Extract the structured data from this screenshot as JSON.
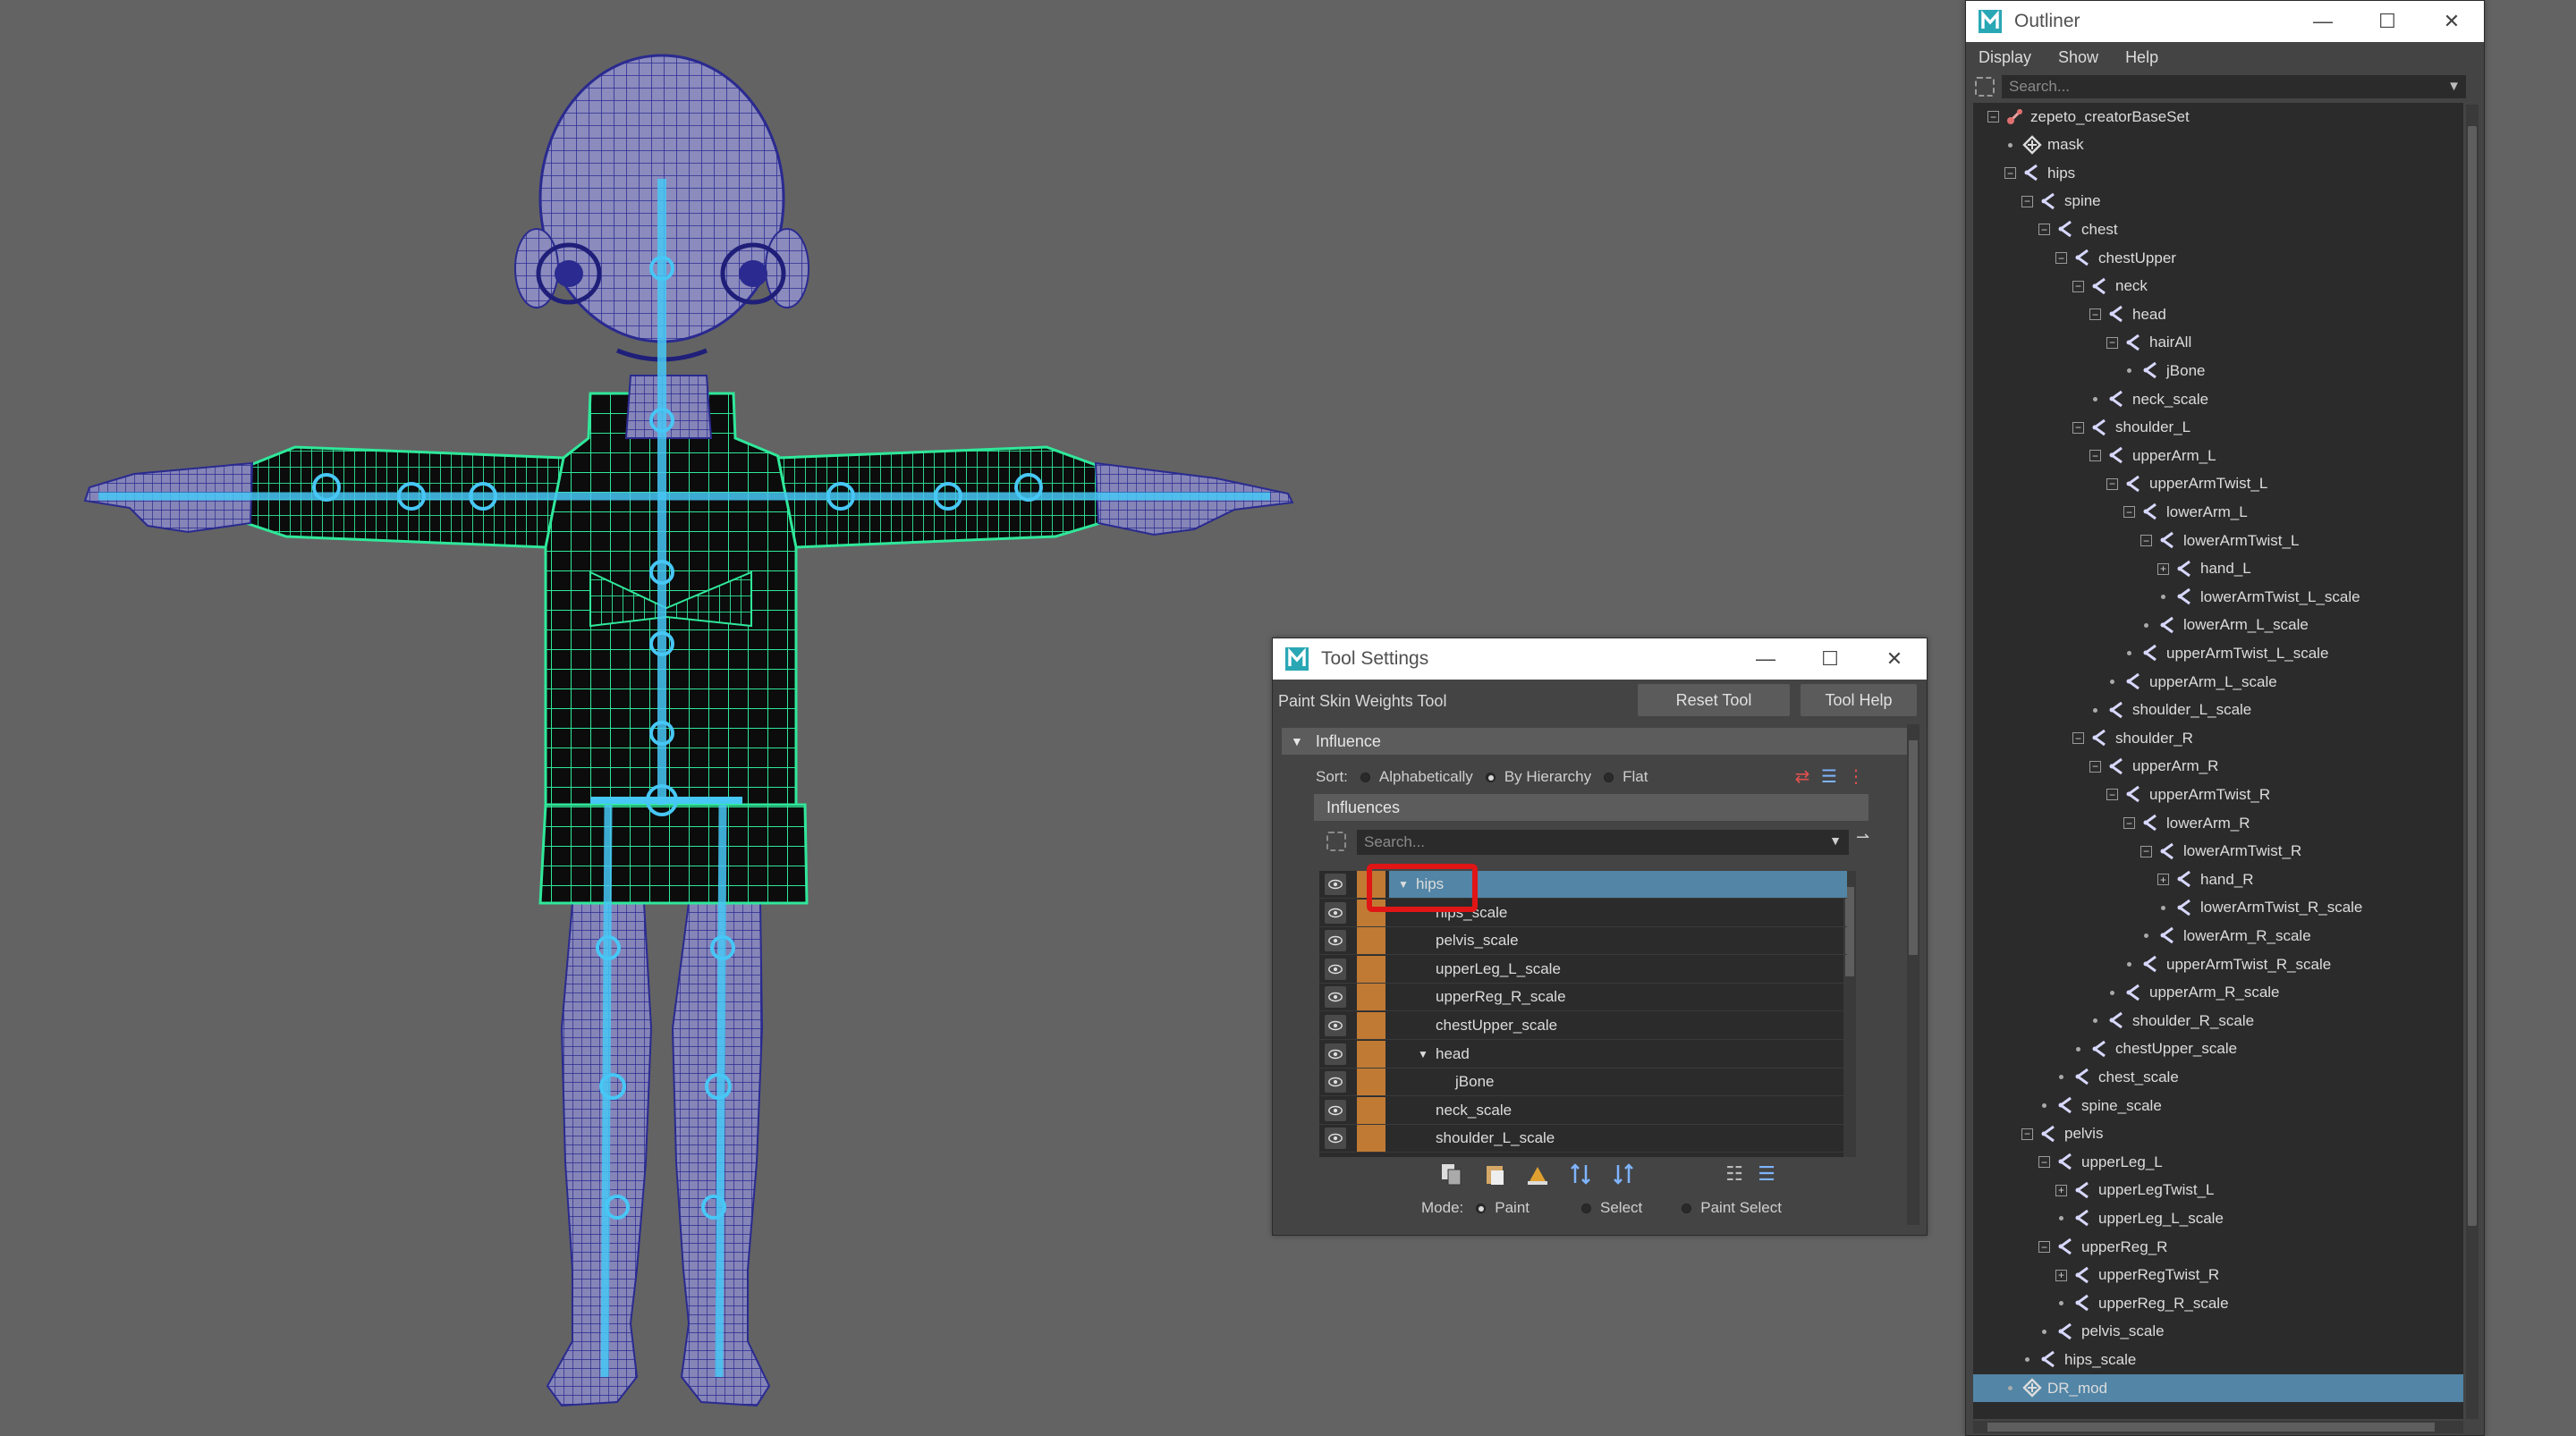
{
  "colors": {
    "viewport_bg": "#636363",
    "selection": "#5285a6",
    "mesh_blue": "#3a3aa6",
    "mesh_green": "#2fe89a",
    "joint_cyan": "#47c7f5",
    "influence_swatch": "#c07a34",
    "highlight_box": "#e01515"
  },
  "outliner": {
    "title": "Outliner",
    "menus": [
      "Display",
      "Show",
      "Help"
    ],
    "search_placeholder": "Search...",
    "items": [
      {
        "label": "zepeto_creatorBaseSet",
        "depth": 0,
        "expander": "minus",
        "icon": "set-icon"
      },
      {
        "label": "mask",
        "depth": 1,
        "expander": "dot",
        "icon": "transform-icon"
      },
      {
        "label": "hips",
        "depth": 1,
        "expander": "minus",
        "icon": "joint-icon"
      },
      {
        "label": "spine",
        "depth": 2,
        "expander": "minus",
        "icon": "joint-icon"
      },
      {
        "label": "chest",
        "depth": 3,
        "expander": "minus",
        "icon": "joint-icon"
      },
      {
        "label": "chestUpper",
        "depth": 4,
        "expander": "minus",
        "icon": "joint-icon"
      },
      {
        "label": "neck",
        "depth": 5,
        "expander": "minus",
        "icon": "joint-icon"
      },
      {
        "label": "head",
        "depth": 6,
        "expander": "minus",
        "icon": "joint-icon"
      },
      {
        "label": "hairAll",
        "depth": 7,
        "expander": "minus",
        "icon": "joint-icon"
      },
      {
        "label": "jBone",
        "depth": 8,
        "expander": "dot",
        "icon": "joint-icon"
      },
      {
        "label": "neck_scale",
        "depth": 6,
        "expander": "dot",
        "icon": "joint-icon"
      },
      {
        "label": "shoulder_L",
        "depth": 5,
        "expander": "minus",
        "icon": "joint-icon"
      },
      {
        "label": "upperArm_L",
        "depth": 6,
        "expander": "minus",
        "icon": "joint-icon"
      },
      {
        "label": "upperArmTwist_L",
        "depth": 7,
        "expander": "minus",
        "icon": "joint-icon"
      },
      {
        "label": "lowerArm_L",
        "depth": 8,
        "expander": "minus",
        "icon": "joint-icon"
      },
      {
        "label": "lowerArmTwist_L",
        "depth": 9,
        "expander": "minus",
        "icon": "joint-icon"
      },
      {
        "label": "hand_L",
        "depth": 10,
        "expander": "plus",
        "icon": "joint-icon"
      },
      {
        "label": "lowerArmTwist_L_scale",
        "depth": 10,
        "expander": "dot",
        "icon": "joint-icon"
      },
      {
        "label": "lowerArm_L_scale",
        "depth": 9,
        "expander": "dot",
        "icon": "joint-icon"
      },
      {
        "label": "upperArmTwist_L_scale",
        "depth": 8,
        "expander": "dot",
        "icon": "joint-icon"
      },
      {
        "label": "upperArm_L_scale",
        "depth": 7,
        "expander": "dot",
        "icon": "joint-icon"
      },
      {
        "label": "shoulder_L_scale",
        "depth": 6,
        "expander": "dot",
        "icon": "joint-icon"
      },
      {
        "label": "shoulder_R",
        "depth": 5,
        "expander": "minus",
        "icon": "joint-icon"
      },
      {
        "label": "upperArm_R",
        "depth": 6,
        "expander": "minus",
        "icon": "joint-icon"
      },
      {
        "label": "upperArmTwist_R",
        "depth": 7,
        "expander": "minus",
        "icon": "joint-icon"
      },
      {
        "label": "lowerArm_R",
        "depth": 8,
        "expander": "minus",
        "icon": "joint-icon"
      },
      {
        "label": "lowerArmTwist_R",
        "depth": 9,
        "expander": "minus",
        "icon": "joint-icon"
      },
      {
        "label": "hand_R",
        "depth": 10,
        "expander": "plus",
        "icon": "joint-icon"
      },
      {
        "label": "lowerArmTwist_R_scale",
        "depth": 10,
        "expander": "dot",
        "icon": "joint-icon"
      },
      {
        "label": "lowerArm_R_scale",
        "depth": 9,
        "expander": "dot",
        "icon": "joint-icon"
      },
      {
        "label": "upperArmTwist_R_scale",
        "depth": 8,
        "expander": "dot",
        "icon": "joint-icon"
      },
      {
        "label": "upperArm_R_scale",
        "depth": 7,
        "expander": "dot",
        "icon": "joint-icon"
      },
      {
        "label": "shoulder_R_scale",
        "depth": 6,
        "expander": "dot",
        "icon": "joint-icon"
      },
      {
        "label": "chestUpper_scale",
        "depth": 5,
        "expander": "dot",
        "icon": "joint-icon"
      },
      {
        "label": "chest_scale",
        "depth": 4,
        "expander": "dot",
        "icon": "joint-icon"
      },
      {
        "label": "spine_scale",
        "depth": 3,
        "expander": "dot",
        "icon": "joint-icon"
      },
      {
        "label": "pelvis",
        "depth": 2,
        "expander": "minus",
        "icon": "joint-icon"
      },
      {
        "label": "upperLeg_L",
        "depth": 3,
        "expander": "minus",
        "icon": "joint-icon"
      },
      {
        "label": "upperLegTwist_L",
        "depth": 4,
        "expander": "plus",
        "icon": "joint-icon"
      },
      {
        "label": "upperLeg_L_scale",
        "depth": 4,
        "expander": "dot",
        "icon": "joint-icon"
      },
      {
        "label": "upperReg_R",
        "depth": 3,
        "expander": "minus",
        "icon": "joint-icon"
      },
      {
        "label": "upperRegTwist_R",
        "depth": 4,
        "expander": "plus",
        "icon": "joint-icon"
      },
      {
        "label": "upperReg_R_scale",
        "depth": 4,
        "expander": "dot",
        "icon": "joint-icon"
      },
      {
        "label": "pelvis_scale",
        "depth": 3,
        "expander": "dot",
        "icon": "joint-icon"
      },
      {
        "label": "hips_scale",
        "depth": 2,
        "expander": "dot",
        "icon": "joint-icon"
      },
      {
        "label": "DR_mod",
        "depth": 1,
        "expander": "dot",
        "icon": "transform-icon",
        "selected": true
      }
    ]
  },
  "tool_settings": {
    "title": "Tool Settings",
    "tool_name": "Paint Skin Weights Tool",
    "reset_button": "Reset Tool",
    "help_button": "Tool Help",
    "influence_section": "Influence",
    "sort_label": "Sort:",
    "sort_options": [
      "Alphabetically",
      "By Hierarchy",
      "Flat"
    ],
    "sort_selected": "By Hierarchy",
    "influences_header": "Influences",
    "search_placeholder": "Search...",
    "influences": [
      {
        "label": "hips",
        "expander": "down",
        "selected": true,
        "indent": 0
      },
      {
        "label": "hips_scale",
        "expander": "",
        "indent": 1
      },
      {
        "label": "pelvis_scale",
        "expander": "",
        "indent": 1
      },
      {
        "label": "upperLeg_L_scale",
        "expander": "",
        "indent": 1
      },
      {
        "label": "upperReg_R_scale",
        "expander": "",
        "indent": 1
      },
      {
        "label": "chestUpper_scale",
        "expander": "",
        "indent": 1
      },
      {
        "label": "head",
        "expander": "down",
        "indent": 1
      },
      {
        "label": "jBone",
        "expander": "",
        "indent": 2
      },
      {
        "label": "neck_scale",
        "expander": "",
        "indent": 1
      },
      {
        "label": "shoulder_L_scale",
        "expander": "",
        "indent": 1
      }
    ],
    "mode_label": "Mode:",
    "mode_options": [
      "Paint",
      "Select",
      "Paint Select"
    ],
    "mode_selected": "Paint"
  }
}
